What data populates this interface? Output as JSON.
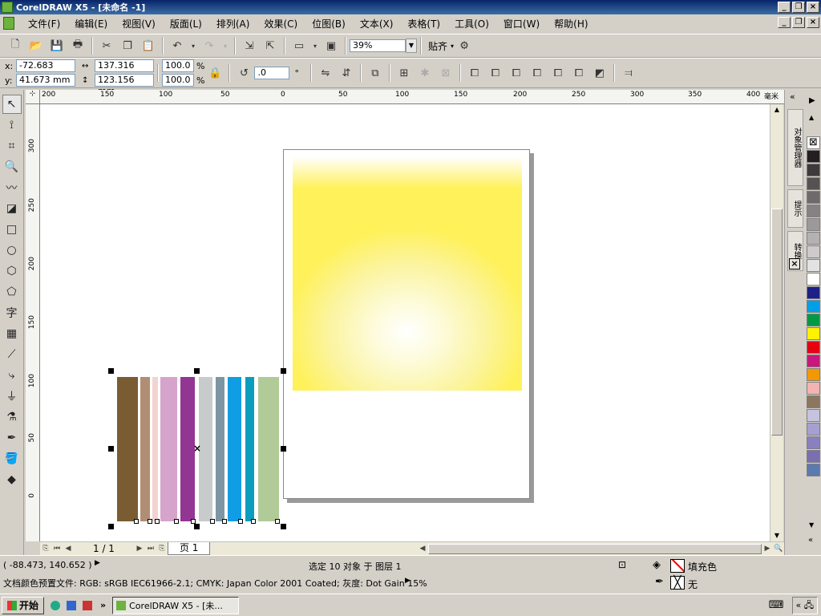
{
  "window": {
    "title": "CorelDRAW X5 - [未命名 -1]",
    "controls": [
      "_",
      "❐",
      "×"
    ]
  },
  "menu": {
    "items": [
      "文件(F)",
      "编辑(E)",
      "视图(V)",
      "版面(L)",
      "排列(A)",
      "效果(C)",
      "位图(B)",
      "文本(X)",
      "表格(T)",
      "工具(O)",
      "窗口(W)",
      "帮助(H)"
    ]
  },
  "standard_toolbar": {
    "zoom_value": "39%",
    "snap_label": "贴齐"
  },
  "property_bar": {
    "x_label": "x:",
    "x_value": "-72.683 mm",
    "y_label": "y:",
    "y_value": "41.673 mm",
    "width_value": "137.316 mm",
    "height_value": "123.156 mm",
    "scale_x": "100.0",
    "scale_y": "100.0",
    "percent": "%",
    "rotation": ".0",
    "degree": "°"
  },
  "hruler": {
    "unit": "毫米",
    "labels": [
      "200",
      "150",
      "100",
      "50",
      "0",
      "50",
      "100",
      "150",
      "200",
      "250",
      "300",
      "350",
      "400"
    ]
  },
  "vruler": {
    "labels": [
      "300",
      "250",
      "200",
      "150",
      "100",
      "50",
      "0"
    ]
  },
  "page_nav": {
    "page_count": "1 / 1",
    "page_tab": "页 1"
  },
  "dockers": {
    "tab1": "对象管理器",
    "tab2": "提示",
    "tab3": "转换"
  },
  "palette": {
    "colors": [
      "#231f20",
      "#3d3a3b",
      "#555253",
      "#6d6a6b",
      "#858283",
      "#9c999a",
      "#b4b1b2",
      "#cccaca",
      "#e3e2e2",
      "#ffffff",
      "#1d2088",
      "#00a0e9",
      "#009944",
      "#fff100",
      "#e60012",
      "#c9177d",
      "#f39800",
      "#f5b2b2",
      "#8b7760",
      "#c4c4e0",
      "#a5a0d0",
      "#8a80c0",
      "#7b6fb0",
      "#5a7ab0"
    ]
  },
  "stripes": {
    "colors": [
      "#7a5c32",
      "#b08e74",
      "#f3d3d0",
      "#d6a3cc",
      "#933592",
      "#c8cbcc",
      "#7e96a3",
      "#109de3",
      "#0b9dbd",
      "#b0cb98"
    ]
  },
  "status": {
    "coords": "( -88.473, 140.652 )",
    "selection": "选定 10 对象 于 图层 1",
    "fill_label": "填充色",
    "outline_label": "无",
    "color_profile": "文档颜色预置文件: RGB: sRGB IEC61966-2.1; CMYK: Japan Color 2001 Coated; 灰度: Dot Gain 15%"
  },
  "taskbar": {
    "start": "开始",
    "app_label": "CorelDRAW X5 - [未..."
  }
}
